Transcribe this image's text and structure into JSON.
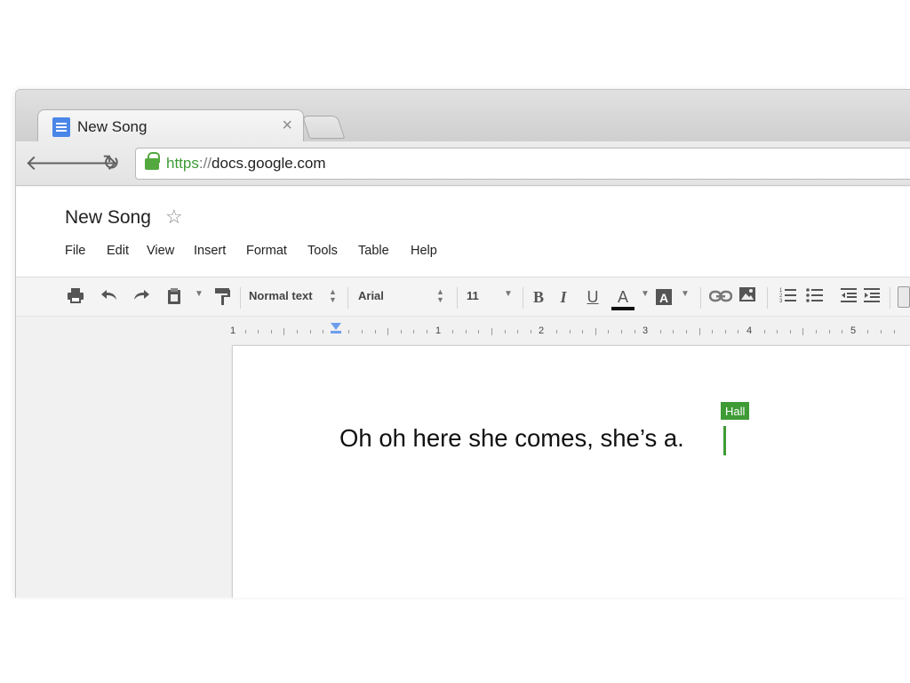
{
  "browser": {
    "tab": {
      "title": "New Song",
      "icon": "google-docs-icon",
      "close_glyph": "×"
    },
    "nav": {
      "back_glyph": "🡐",
      "forward_glyph": "🡒",
      "reload_glyph": "↻"
    },
    "url": {
      "scheme": "https",
      "separator": "://",
      "host": "docs.google.com",
      "lock_color": "#53a93f"
    }
  },
  "docs": {
    "title": "New Song",
    "star_glyph": "☆",
    "menu": [
      "File",
      "Edit",
      "View",
      "Insert",
      "Format",
      "Tools",
      "Table",
      "Help"
    ],
    "toolbar": {
      "style_value": "Normal text",
      "font_value": "Arial",
      "size_value": "11",
      "bold_label": "B",
      "italic_label": "I",
      "underline_label": "U",
      "text_color_label": "A",
      "highlight_label": "A"
    },
    "ruler": {
      "labels": [
        "1",
        "1",
        "2",
        "3",
        "4",
        "5"
      ]
    },
    "page": {
      "text": "Oh oh here she comes, she’s a.",
      "collaborator": {
        "name": "Hall",
        "color": "#3e9b35"
      }
    }
  }
}
